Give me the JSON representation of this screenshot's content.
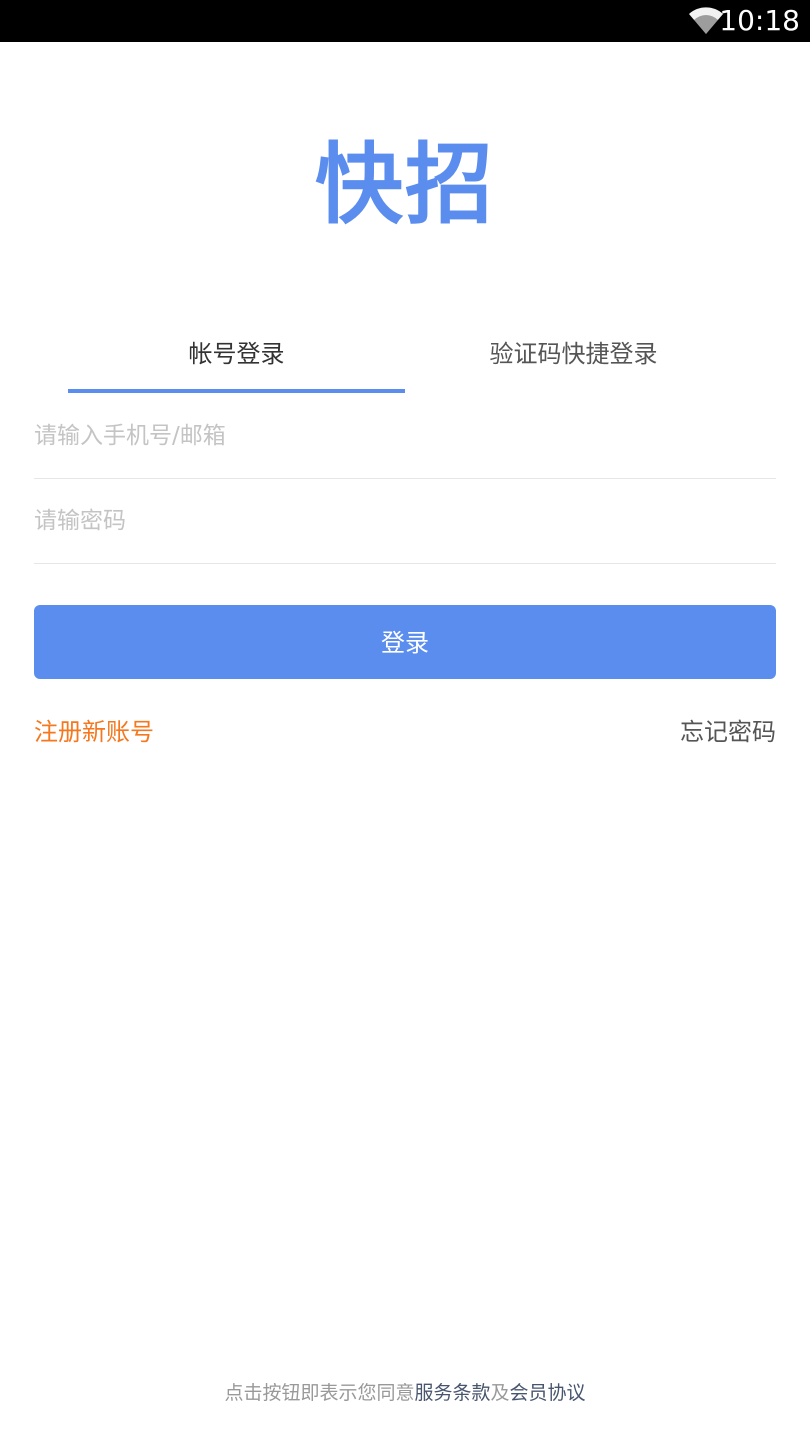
{
  "status_bar": {
    "time": "10:18",
    "wifi_icon": "wifi-icon"
  },
  "app": {
    "logo_text": "快招",
    "brand_color": "#5b8def"
  },
  "tabs": [
    {
      "label": "帐号登录",
      "active": true
    },
    {
      "label": "验证码快捷登录",
      "active": false
    }
  ],
  "form": {
    "account_placeholder": "请输入手机号/邮箱",
    "account_value": "",
    "password_placeholder": "请输密码",
    "password_value": "",
    "login_label": "登录"
  },
  "links": {
    "register": "注册新账号",
    "register_color": "#f5781e",
    "forgot": "忘记密码"
  },
  "footer": {
    "prefix": "点击按钮即表示您同意",
    "terms": "服务条款",
    "conjunction": "及",
    "agreement": "会员协议"
  }
}
